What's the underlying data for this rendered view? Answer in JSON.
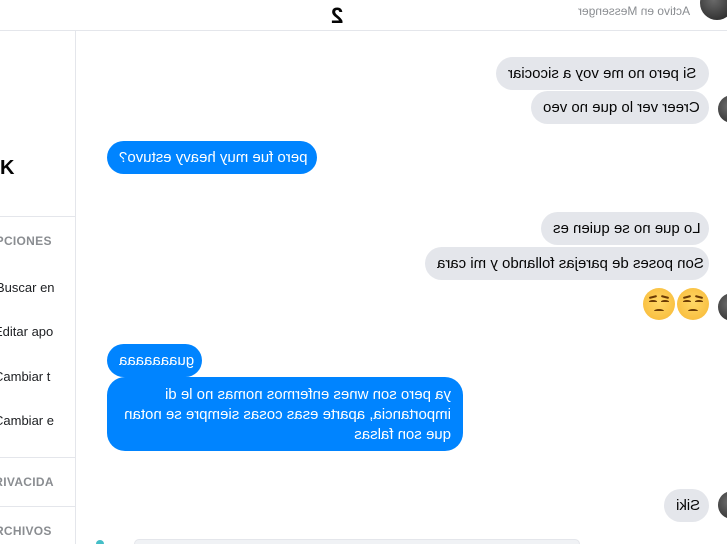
{
  "header": {
    "chat_name": "2",
    "status": "Activo en Messenger"
  },
  "sidebar": {
    "title": "K",
    "options_heading": "OPCIONES",
    "items": [
      "Buscar en",
      "Editar apo",
      "Cambiar t",
      "Cambiar e"
    ],
    "privacy_heading": "PRIVACIDA",
    "files_heading": "ARCHIVOS"
  },
  "messages": [
    {
      "side": "in",
      "text": "Si pero no me voy a sicociar"
    },
    {
      "side": "in",
      "text": "Creer ver lo que no veo"
    },
    {
      "side": "out",
      "text": "pero fue muy heavy estuvo?"
    },
    {
      "side": "in",
      "text": "Lo que no se quien es"
    },
    {
      "side": "in",
      "text": "Son poses de parejas follando y mi cara"
    },
    {
      "side": "in",
      "emoji": "pensive-face-emoji x2"
    },
    {
      "side": "out",
      "text": "guaaaaaaa"
    },
    {
      "side": "out",
      "lines": [
        "ya pero son wnes enfermos nomas no le di",
        "importancia, aparte esas cosas siempre se notan",
        "que son falsas"
      ]
    },
    {
      "side": "in",
      "text": "Siki"
    }
  ],
  "colors": {
    "outgoing": "#0084ff",
    "incoming": "#e4e6eb",
    "divider": "#e4e6eb"
  }
}
